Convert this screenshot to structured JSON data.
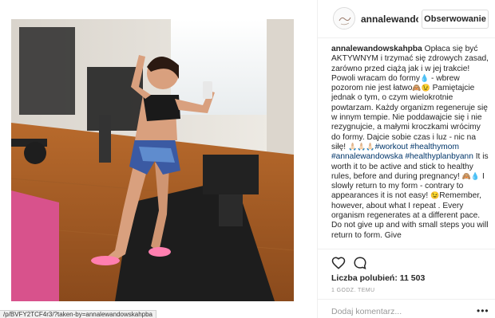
{
  "post": {
    "username": "annalewandowskahpba",
    "username_header": "annalewandow",
    "follow_label": "Obserwowanie"
  },
  "caption": {
    "username": "annalewandowskahpba",
    "seg1": "Opłaca się być AKTYWNYM i trzymać się zdrowych zasad, zarówno przed ciążą jak i w jej trakcie! Powoli wracam do formy",
    "seg2": " - wbrew pozorom nie jest łatwo",
    "seg3": " Pamiętajcie jednak o tym, o czym wielokrotnie powtarzam. Każdy organizm regeneruje się w innym tempie. Nie poddawajcie się i nie rezygnujcie, a małymi kroczkami wrócimy do formy. Dajcie sobie czas i luz - nic na siłę!",
    "tag1": "#workout",
    "tag2": "#healthymom",
    "tag3": "#annalewandowska",
    "tag4": "#healthyplanbyann",
    "seg4": " It is worth it to be active and stick to healthy rules, before and during pregnancy!",
    "seg5": " I slowly return to my form - contrary to appearances it is not easy!",
    "seg6": "Remember, however, about what I repeat . Every organism regenerates at a different pace. Do not give up and with small steps you will return to form. Give"
  },
  "actions": {
    "like_icon": "heart-icon",
    "comment_icon": "comment-icon",
    "likes_text": "Liczba polubień: 11 503",
    "time_ago": "1 GODZ. TEMU",
    "comment_placeholder": "Dodaj komentarz...",
    "more_icon": "more-options-icon"
  },
  "status_bar": {
    "url": "/p/BVFY2TCF4r3/?taken-by=annalewandowskahpba"
  },
  "colors": {
    "text": "#262626",
    "muted": "#999999",
    "border": "#efefef",
    "hashtag": "#003569"
  }
}
